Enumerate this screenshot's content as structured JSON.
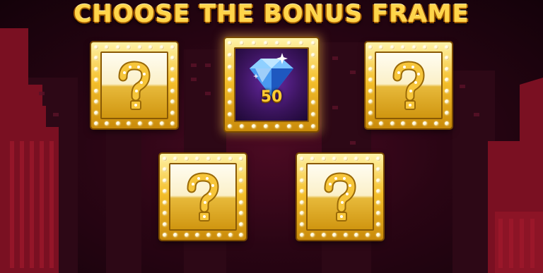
{
  "header": {
    "title": "CHOOSE THE BONUS FRAME"
  },
  "frames": [
    {
      "state": "hidden",
      "icon": "question-mark-icon"
    },
    {
      "state": "revealed",
      "icon": "diamond-icon",
      "value": "50"
    },
    {
      "state": "hidden",
      "icon": "question-mark-icon"
    },
    {
      "state": "hidden",
      "icon": "question-mark-icon"
    },
    {
      "state": "hidden",
      "icon": "question-mark-icon"
    }
  ],
  "colors": {
    "gold": "#f5c02c",
    "background": "#2a0514",
    "accent_purple": "#3b145e"
  }
}
